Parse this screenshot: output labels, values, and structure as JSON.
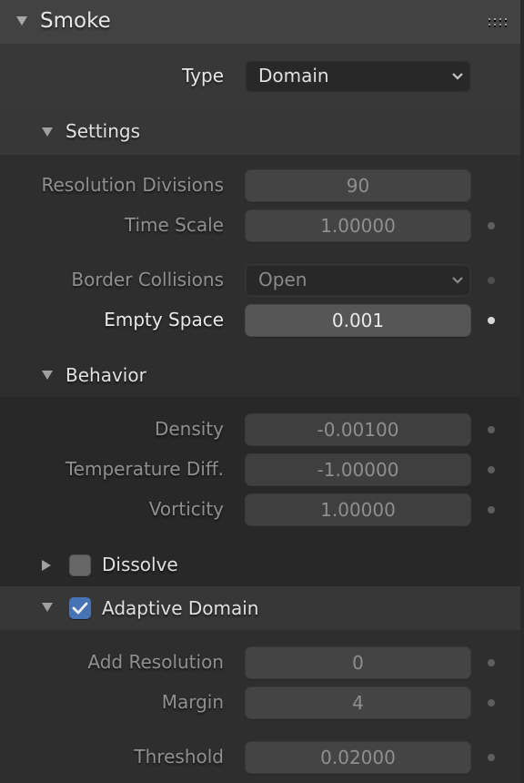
{
  "panel": {
    "title": "Smoke",
    "type_label": "Type",
    "type_value": "Domain"
  },
  "settings": {
    "title": "Settings",
    "resolution_divisions_label": "Resolution Divisions",
    "resolution_divisions_value": "90",
    "time_scale_label": "Time Scale",
    "time_scale_value": "1.00000",
    "border_collisions_label": "Border Collisions",
    "border_collisions_value": "Open",
    "empty_space_label": "Empty Space",
    "empty_space_value": "0.001"
  },
  "behavior": {
    "title": "Behavior",
    "density_label": "Density",
    "density_value": "-0.00100",
    "temperature_label": "Temperature Diff.",
    "temperature_value": "-1.00000",
    "vorticity_label": "Vorticity",
    "vorticity_value": "1.00000"
  },
  "dissolve": {
    "title": "Dissolve",
    "checked": false
  },
  "adaptive_domain": {
    "title": "Adaptive Domain",
    "checked": true,
    "add_resolution_label": "Add Resolution",
    "add_resolution_value": "0",
    "margin_label": "Margin",
    "margin_value": "4",
    "threshold_label": "Threshold",
    "threshold_value": "0.02000"
  },
  "colors": {
    "accent": "#4772b3",
    "header_bg": "#424242",
    "panel_bg": "#383838",
    "subpanel_bg": "#2e2e2e",
    "field_bg": "#444444",
    "active_field_bg": "#565656"
  }
}
